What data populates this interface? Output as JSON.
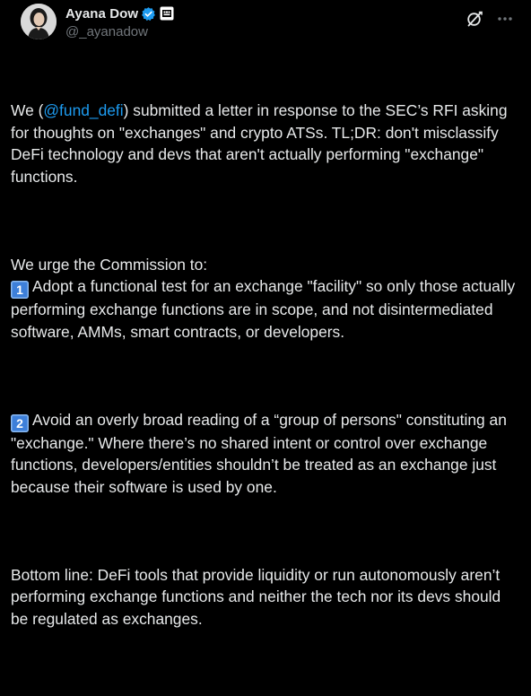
{
  "author": {
    "display_name": "Ayana Dow",
    "handle": "@_ayanadow"
  },
  "icons": {
    "verified": "verified-badge-icon",
    "affiliation": "affiliation-badge-icon",
    "grok": "grok-icon",
    "more": "more-options-icon"
  },
  "colors": {
    "background": "#000000",
    "text": "#e7e9ea",
    "secondary": "#71767b",
    "accent": "#1d9bf0"
  },
  "post": {
    "p1_before": "We (",
    "p1_mention": "@fund_defi",
    "p1_after": ") submitted a letter in response to the SEC’s RFI asking for thoughts on \"exchanges\" and crypto ATSs. TL;DR: don't misclassify DeFi technology and devs that aren't actually performing \"exchange\" functions.",
    "p2": "We urge the Commission to:",
    "item1_number": "1",
    "item1_text": "Adopt a functional test for an exchange \"facility\" so only those actually performing exchange functions are in scope, and not disintermediated software, AMMs, smart contracts, or developers.",
    "item2_number": "2",
    "item2_text": "Avoid an overly broad reading of a “group of persons\" constituting an \"exchange.\" Where there’s no shared intent or control over exchange functions, developers/entities shouldn’t be treated as an exchange just because their software is used by one.",
    "p_bottom": "Bottom line: DeFi tools that provide liquidity or run autonomously aren’t performing exchange functions and neither the tech nor its devs should be regulated as exchanges."
  }
}
